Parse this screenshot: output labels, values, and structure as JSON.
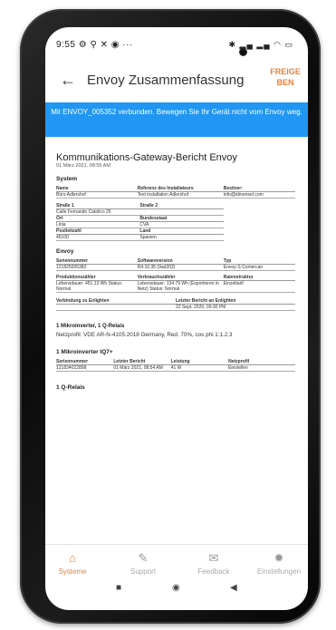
{
  "statusbar": {
    "time": "9:55",
    "left_icons": "⚙ ⚲ ✕ ◉ ···",
    "right_icons": "✱ ▂▄ ▂▄ ◠ ▭"
  },
  "header": {
    "title": "Envoy Zusammenfassung",
    "action": "FREIGEBEN"
  },
  "banner": {
    "text": "Mit ENVOY_005352 verbunden. Bewegen Sie Ihr Gerät nicht vom Envoy weg."
  },
  "report": {
    "title": "Kommunikations-Gateway-Bericht Envoy",
    "date": "01 März 2021, 08:55 AM",
    "system": {
      "heading": "System",
      "headers": [
        "Name",
        "Referenz des Installateurs",
        "Besitzer:"
      ],
      "row": [
        "Büro Adlershof",
        "Test installation Adlershof",
        "info@idmensel.com"
      ],
      "addr_headers1": [
        "Straße 1",
        "Straße 2"
      ],
      "addr_row1": [
        "Calle Fernando Catolico 25",
        ""
      ],
      "addr_headers2": [
        "Ort",
        "Bundesstaat"
      ],
      "addr_row2": [
        "Linia",
        "CVA"
      ],
      "addr_headers3": [
        "Postleitzahl",
        "Land"
      ],
      "addr_row3": [
        "46100",
        "Spanien"
      ]
    },
    "envoy": {
      "heading": "Envoy",
      "headers": [
        "Seriennummer",
        "Softwareversion",
        "Typ"
      ],
      "row": [
        "121825005382",
        "R4.10.35 (9ad202)",
        "Envoy-S Comercan"
      ],
      "headers2": [
        "Produktionszähler",
        "Verbrauchszähler",
        "Ratenstruktur"
      ],
      "row2": [
        "Lebensdauer: 451.13 Wh Status: Normal",
        "Lebensdauer: 134.79 Wh (Exportieren in Netz) Status: Normal",
        "Einzeltarif"
      ],
      "headers3": [
        "Verbindung zu Enlighten",
        "Letzter Bericht an Enlighten"
      ],
      "row3": [
        "",
        "22 Sept. 2020, 09:30 PM"
      ]
    },
    "micro": {
      "line1": "1 Mikroinverter, 1 Q-Relais",
      "netz": "Netzprofil: VDE AR-N-4105:2018 Germany, Red. 70%, cos phi 1:1.2.3",
      "heading": "1 Mikroinverter IQ7+",
      "headers": [
        "Seriennummer",
        "Letzter Bericht",
        "Leistung",
        "Netzprofil"
      ],
      "row": [
        "121834022898",
        "01 März 2021, 08:54 AM",
        "41 W",
        "Einstellen"
      ],
      "relais": "1 Q-Relais"
    }
  },
  "tabs": [
    {
      "label": "Systeme",
      "icon": "⌂"
    },
    {
      "label": "Support",
      "icon": "✎"
    },
    {
      "label": "Feedback",
      "icon": "✉"
    },
    {
      "label": "Einstellungen",
      "icon": "✹"
    }
  ],
  "nav": {
    "recent": "■",
    "home": "◉",
    "back": "◀"
  },
  "colors": {
    "accent": "#e8803a",
    "banner": "#2196f3"
  }
}
